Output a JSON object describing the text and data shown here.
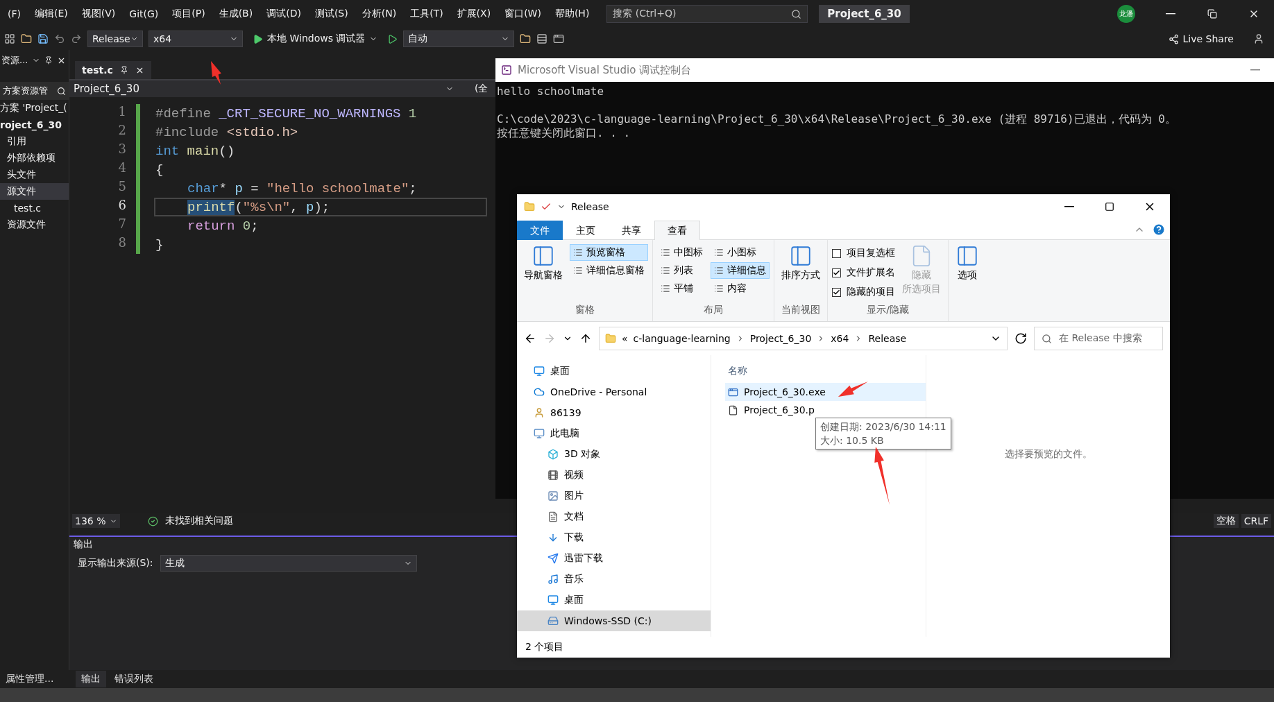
{
  "menu": [
    "(F)",
    "编辑(E)",
    "视图(V)",
    "Git(G)",
    "项目(P)",
    "生成(B)",
    "调试(D)",
    "测试(S)",
    "分析(N)",
    "工具(T)",
    "扩展(X)",
    "窗口(W)",
    "帮助(H)"
  ],
  "search": {
    "placeholder": "搜索 (Ctrl+Q)"
  },
  "title": "Project_6_30",
  "account": "龙潘",
  "toolbar": {
    "configuration": "Release",
    "platform": "x64",
    "run": "本地 Windows 调试器",
    "mode": "自动",
    "live_share": "Live Share"
  },
  "solution_explorer": {
    "header": "资源...",
    "search": "方案资源管",
    "tree": [
      {
        "label": "方案 'Project_(",
        "selected": false,
        "children": [
          {
            "label": "roject_6_30",
            "selected": false,
            "children": [
              {
                "label": "引用",
                "selected": false
              },
              {
                "label": "外部依赖项",
                "selected": false
              },
              {
                "label": "头文件",
                "selected": false
              },
              {
                "label": "源文件",
                "selected": true,
                "children": [
                  {
                    "label": "test.c",
                    "selected": false
                  }
                ]
              },
              {
                "label": "资源文件",
                "selected": false
              }
            ]
          }
        ]
      }
    ]
  },
  "editor": {
    "tab": "test.c",
    "scope": "Project_6_30",
    "member": "(全",
    "lines": [
      {
        "number": "1",
        "indented": false,
        "current": false,
        "tokens": [
          {
            "text": "#define ",
            "kind": "directive"
          },
          {
            "text": "_CRT_SECURE_NO_WARNINGS",
            "kind": "macro"
          },
          {
            "text": " 1",
            "kind": "number"
          }
        ]
      },
      {
        "number": "2",
        "indented": false,
        "current": false,
        "tokens": [
          {
            "text": "#include ",
            "kind": "directive"
          },
          {
            "text": "<stdio.h>",
            "kind": "header"
          }
        ]
      },
      {
        "number": "3",
        "indented": false,
        "current": false,
        "tokens": [
          {
            "text": "int",
            "kind": "keyword"
          },
          {
            "text": " main",
            "kind": "function"
          },
          {
            "text": "()",
            "kind": "plain"
          }
        ]
      },
      {
        "number": "4",
        "indented": false,
        "current": false,
        "tokens": [
          {
            "text": "{",
            "kind": "plain"
          }
        ]
      },
      {
        "number": "5",
        "indented": true,
        "current": false,
        "tokens": [
          {
            "text": "char",
            "kind": "keyword"
          },
          {
            "text": "* ",
            "kind": "plain"
          },
          {
            "text": "p",
            "kind": "variable"
          },
          {
            "text": " = ",
            "kind": "plain"
          },
          {
            "text": "\"hello schoolmate\"",
            "kind": "string"
          },
          {
            "text": ";",
            "kind": "plain"
          }
        ]
      },
      {
        "number": "6",
        "indented": true,
        "current": true,
        "tokens": [
          {
            "text": "printf",
            "kind": "selection"
          },
          {
            "text": "(",
            "kind": "plain"
          },
          {
            "text": "\"%s\\n\"",
            "kind": "string"
          },
          {
            "text": ", ",
            "kind": "plain"
          },
          {
            "text": "p",
            "kind": "variable"
          },
          {
            "text": ");",
            "kind": "plain"
          }
        ]
      },
      {
        "number": "7",
        "indented": true,
        "current": false,
        "tokens": [
          {
            "text": "return",
            "kind": "control"
          },
          {
            "text": " 0",
            "kind": "number"
          },
          {
            "text": ";",
            "kind": "plain"
          }
        ]
      },
      {
        "number": "8",
        "indented": false,
        "current": false,
        "tokens": [
          {
            "text": "}",
            "kind": "plain"
          }
        ]
      }
    ],
    "zoom": "136 %",
    "issues": "未找到相关问题",
    "indent": "空格",
    "line_ending": "CRLF"
  },
  "output": {
    "title": "输出",
    "source_label": "显示输出来源(S):",
    "source": "生成"
  },
  "bottom_tabs": [
    {
      "label": "属性管理...",
      "selected": false
    },
    {
      "label": "输出",
      "selected": true
    },
    {
      "label": "错误列表",
      "selected": false
    }
  ],
  "console": {
    "title": "Microsoft Visual Studio 调试控制台",
    "program_output": "hello schoolmate",
    "exit_lines": [
      "C:\\code\\2023\\c-language-learning\\Project_6_30\\x64\\Release\\Project_6_30.exe (进程 89716)已退出，代码为 0。",
      "按任意键关闭此窗口. . ."
    ]
  },
  "explorer": {
    "title": "Release",
    "ribbon_tabs": [
      {
        "label": "文件",
        "kind": "file",
        "selected": false
      },
      {
        "label": "主页",
        "kind": "tab",
        "selected": false
      },
      {
        "label": "共享",
        "kind": "tab",
        "selected": false
      },
      {
        "label": "查看",
        "kind": "tab",
        "selected": true
      }
    ],
    "groups": [
      {
        "title": "窗格",
        "items": [
          {
            "label": "导航窗格",
            "kind": "large",
            "selected": false
          },
          {
            "label": "预览窗格",
            "kind": "small",
            "selected": true
          },
          {
            "label": "详细信息窗格",
            "kind": "small",
            "selected": false
          }
        ]
      },
      {
        "title": "布局",
        "items": [
          {
            "label": "中图标",
            "kind": "small",
            "selected": false
          },
          {
            "label": "列表",
            "kind": "small",
            "selected": false
          },
          {
            "label": "平铺",
            "kind": "small",
            "selected": false
          },
          {
            "label": "小图标",
            "kind": "small",
            "selected": false
          },
          {
            "label": "详细信息",
            "kind": "small",
            "selected": true
          },
          {
            "label": "内容",
            "kind": "small",
            "selected": false
          }
        ]
      },
      {
        "title": "当前视图",
        "items": [
          {
            "label": "排序方式",
            "kind": "large",
            "selected": false
          }
        ]
      },
      {
        "title": "显示/隐藏",
        "items": [
          {
            "label": "项目复选框",
            "kind": "check",
            "checked": false
          },
          {
            "label": "文件扩展名",
            "kind": "check",
            "checked": true
          },
          {
            "label": "隐藏的项目",
            "kind": "check",
            "checked": true
          },
          {
            "label_lines": [
              "隐藏",
              "所选项目"
            ],
            "kind": "disabled-large"
          }
        ]
      },
      {
        "items": [
          {
            "label": "选项",
            "kind": "large",
            "selected": false
          }
        ]
      }
    ],
    "path": [
      "«",
      "c-language-learning",
      "Project_6_30",
      "x64",
      "Release"
    ],
    "search": {
      "placeholder": "在 Release 中搜索"
    },
    "nav": [
      {
        "label": "桌面",
        "kind": "desktop",
        "selected": false
      },
      {
        "label": "OneDrive - Personal",
        "kind": "cloud",
        "selected": false
      },
      {
        "label": "86139",
        "kind": "user",
        "selected": false
      },
      {
        "label": "此电脑",
        "kind": "pc",
        "selected": false,
        "children": [
          {
            "label": "3D 对象",
            "kind": "cube",
            "selected": false
          },
          {
            "label": "视频",
            "kind": "video",
            "selected": false
          },
          {
            "label": "图片",
            "kind": "image",
            "selected": false
          },
          {
            "label": "文档",
            "kind": "doc",
            "selected": false
          },
          {
            "label": "下载",
            "kind": "download",
            "selected": false
          },
          {
            "label": "迅雷下载",
            "kind": "bird",
            "selected": false
          },
          {
            "label": "音乐",
            "kind": "music",
            "selected": false
          },
          {
            "label": "桌面",
            "kind": "desktop",
            "selected": false
          },
          {
            "label": "Windows-SSD (C:)",
            "kind": "drive",
            "selected": true
          }
        ]
      }
    ],
    "column": "名称",
    "files": [
      {
        "name": "Project_6_30.exe",
        "kind": "exe",
        "selected": true
      },
      {
        "name": "Project_6_30.p",
        "kind": "pdb",
        "selected": false
      }
    ],
    "tooltip": [
      "创建日期: 2023/6/30 14:11",
      "大小: 10.5 KB"
    ],
    "preview": "选择要预览的文件。",
    "status": "2 个项目"
  }
}
